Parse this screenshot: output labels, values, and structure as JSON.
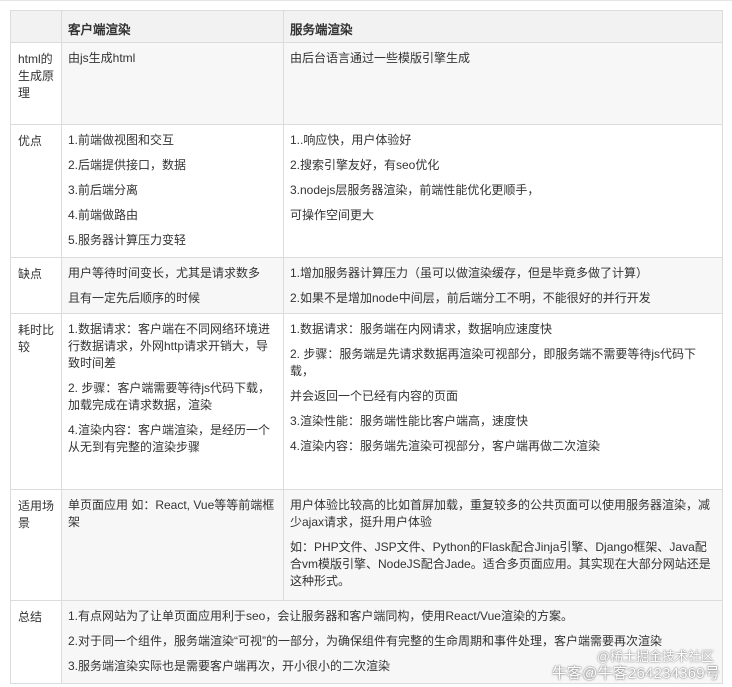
{
  "header": {
    "col1": "",
    "col2": "客户端渲染",
    "col3": "服务端渲染"
  },
  "rows": [
    {
      "label": "html的生成原理",
      "client": [
        "由js生成html"
      ],
      "server": [
        "由后台语言通过一些模版引擎生成"
      ]
    },
    {
      "label": "优点",
      "client": [
        "1.前端做视图和交互",
        "2.后端提供接口，数据",
        "3.前后端分离",
        "4.前端做路由",
        "5.服务器计算压力变轻"
      ],
      "server": [
        "1..响应快，用户体验好",
        "2.搜索引擎友好，有seo优化",
        "3.nodejs层服务器渲染，前端性能优化更顺手，",
        "可操作空间更大"
      ]
    },
    {
      "label": "缺点",
      "client": [
        "用户等待时间变长，尤其是请求数多",
        "且有一定先后顺序的时候"
      ],
      "server": [
        "1.增加服务器计算压力（虽可以做渲染缓存，但是毕竟多做了计算）",
        "2.如果不是增加node中间层，前后端分工不明，不能很好的并行开发"
      ]
    },
    {
      "label": "耗时比较",
      "client": [
        "1.数据请求：客户端在不同网络环境进行数据请求，外网http请求开销大，导致时间差",
        "2. 步骤：客户端需要等待js代码下载，加载完成在请求数据，渲染",
        "4.渲染内容：客户端渲染，是经历一个从无到有完整的渲染步骤"
      ],
      "server": [
        "1.数据请求：服务端在内网请求，数据响应速度快",
        "2. 步骤：服务端是先请求数据再渲染可视部分，即服务端不需要等待js代码下载，",
        "并会返回一个已经有内容的页面",
        "3.渲染性能：服务端性能比客户端高，速度快",
        "4.渲染内容：服务端先渲染可视部分，客户端再做二次渲染"
      ]
    },
    {
      "label": "适用场景",
      "client": [
        "单页面应用 如：React, Vue等等前端框架"
      ],
      "server": [
        "用户体验比较高的比如首屏加载，重复较多的公共页面可以使用服务器渲染，减少ajax请求，挺升用户体验",
        "如：PHP文件、JSP文件、Python的Flask配合Jinja引擎、Django框架、Java配合vm模版引擎、NodeJS配合Jade。适合多页面应用。其实现在大部分网站还是这种形式。"
      ]
    },
    {
      "label": "总结",
      "summary": [
        "1.有点网站为了让单页面应用利于seo，会让服务器和客户端同构，使用React/Vue渲染的方案。",
        "2.对于同一个组件，服务端渲染“可视”的一部分，为确保组件有完整的生命周期和事件处理，客户端需要再次渲染",
        "3.服务端渲染实际也是需要客户端再次，开小很小的二次渲染"
      ]
    }
  ],
  "watermark": {
    "line1": "@稀土掘金技术社区",
    "line2": "牛客@牛客264234369号"
  }
}
